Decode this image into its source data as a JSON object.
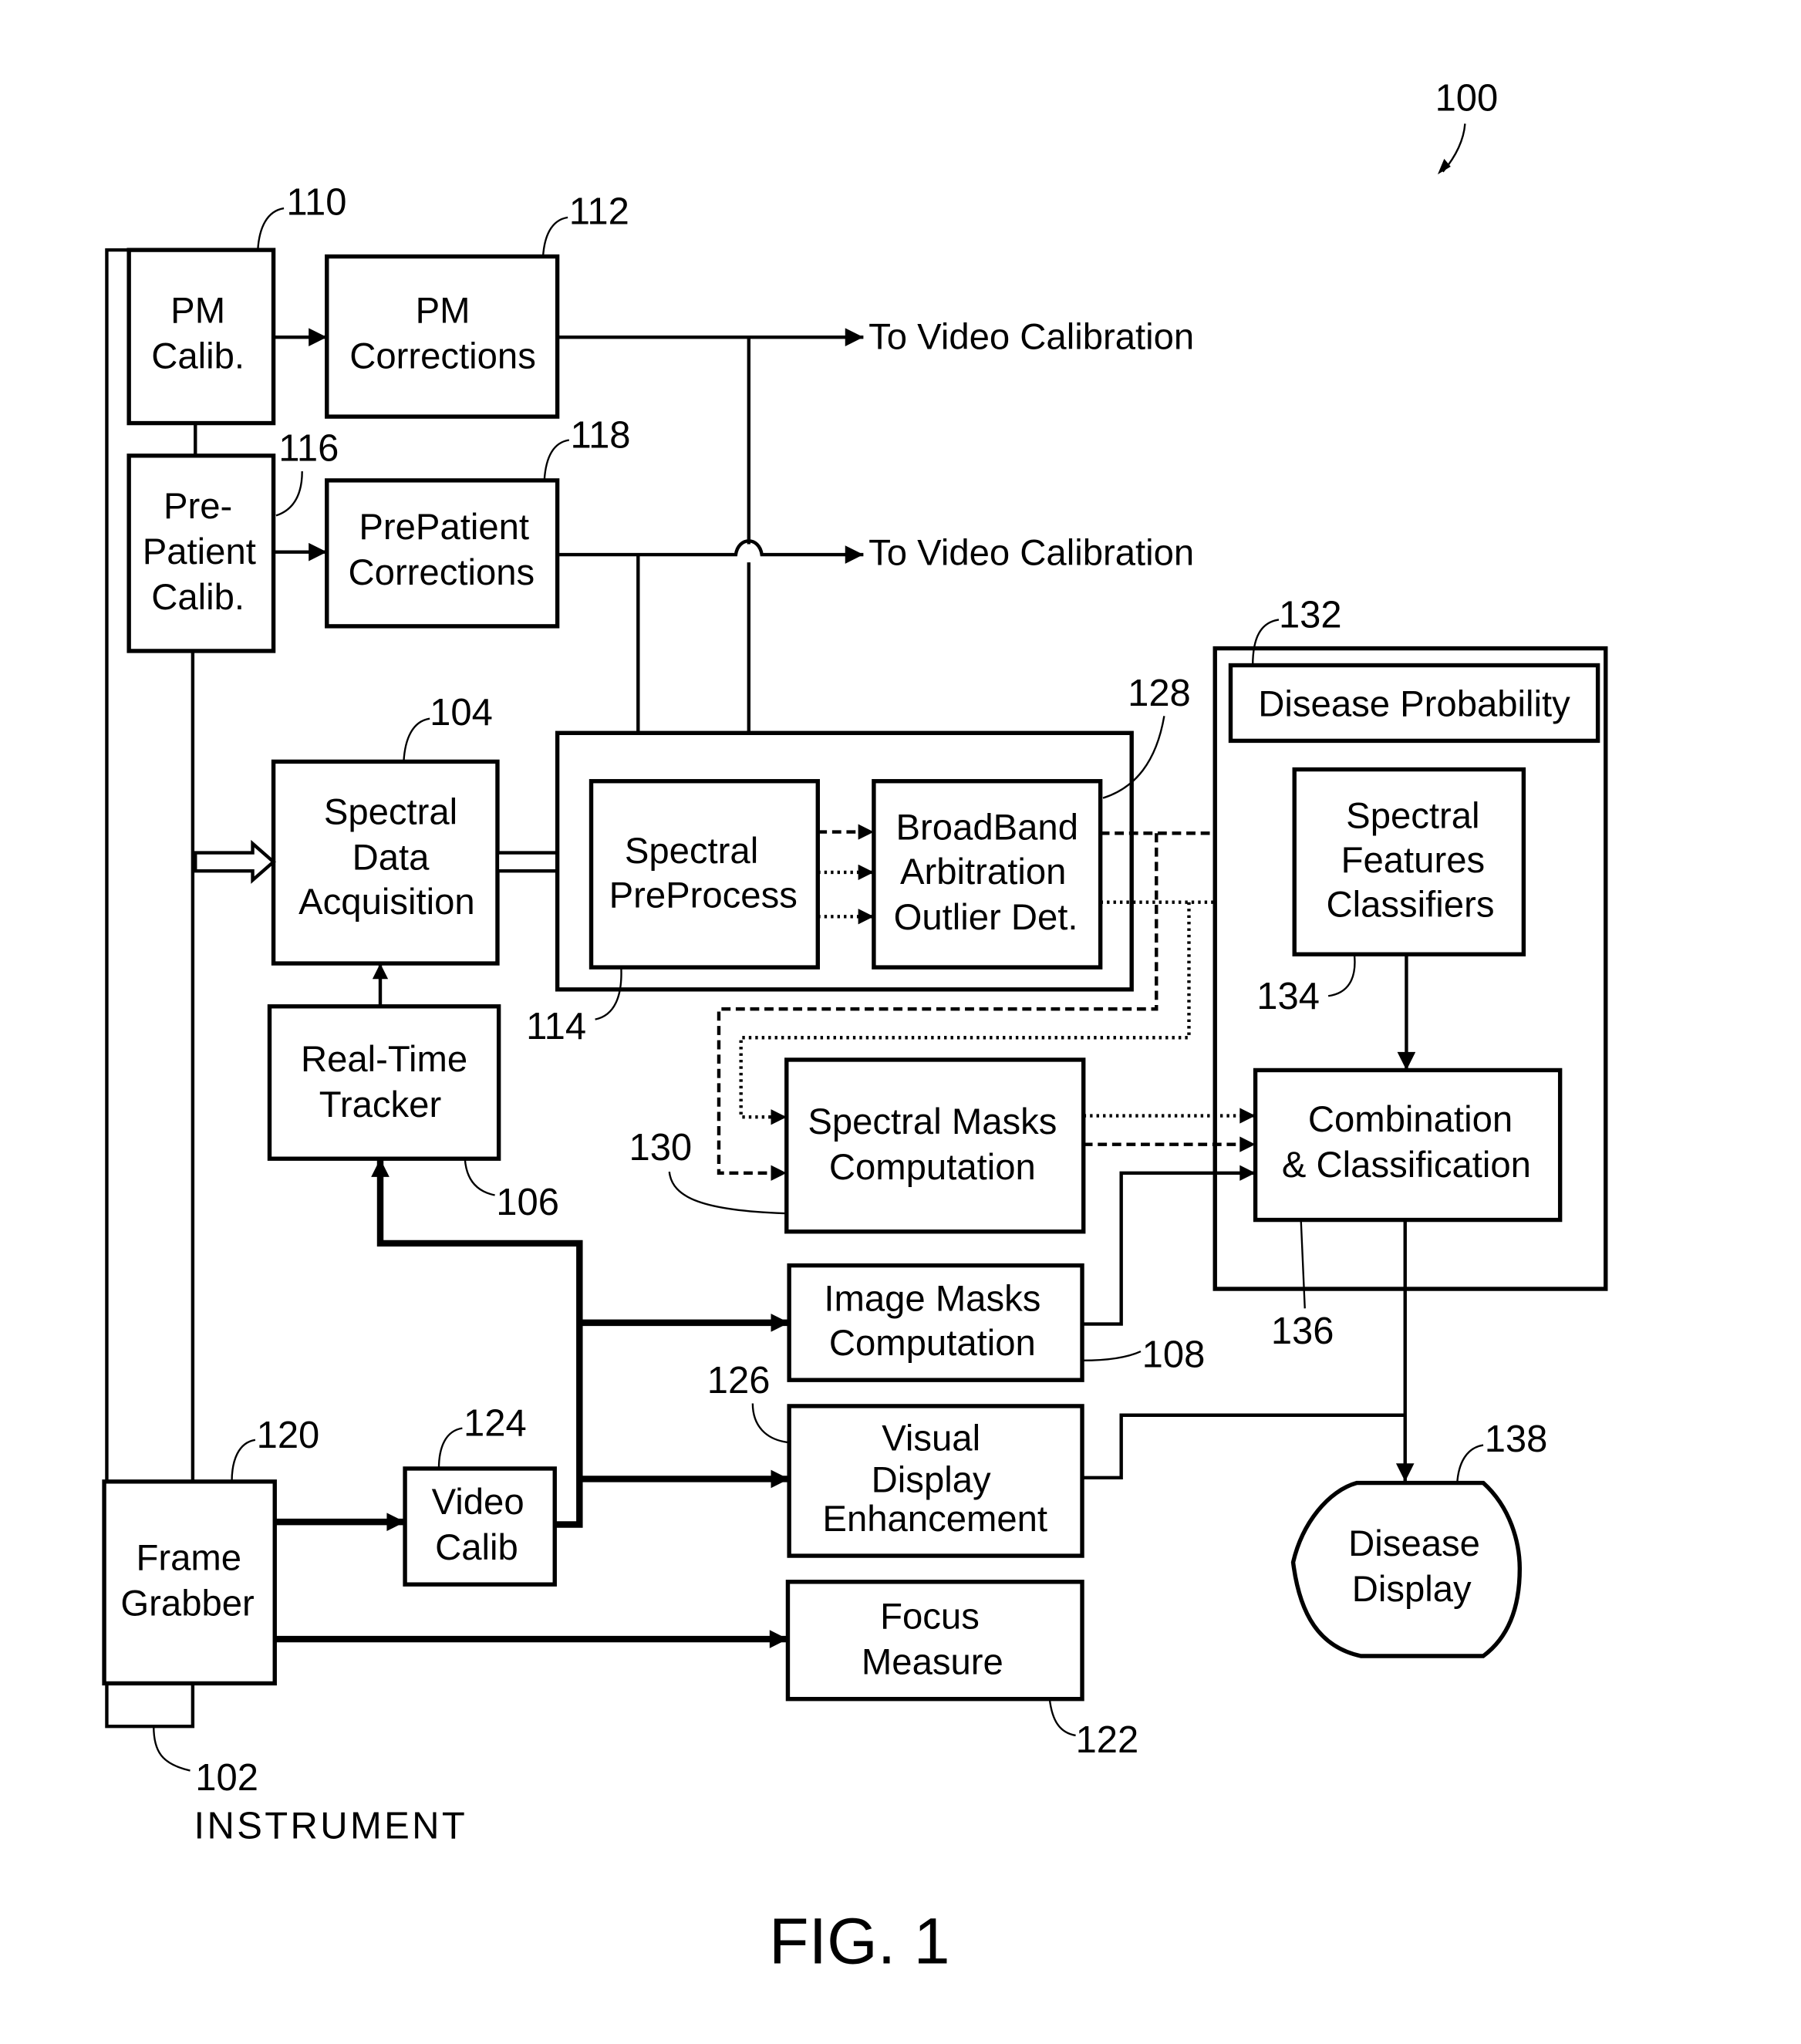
{
  "figure": {
    "title": "FIG. 1",
    "system_ref": "100",
    "instrument_ref": "102",
    "instrument_label": "INSTRUMENT"
  },
  "blocks": {
    "pm_calib": {
      "ref": "110",
      "lines": [
        "PM",
        "Calib."
      ]
    },
    "pm_corrections": {
      "ref": "112",
      "lines": [
        "PM",
        "Corrections"
      ]
    },
    "pre_patient_calib": {
      "ref": "116",
      "lines": [
        "Pre-",
        "Patient",
        "Calib."
      ]
    },
    "prepatient_corrections": {
      "ref": "118",
      "lines": [
        "PrePatient",
        "Corrections"
      ]
    },
    "spectral_data_acquisition": {
      "ref": "104",
      "lines": [
        "Spectral",
        "Data",
        "Acquisition"
      ]
    },
    "real_time_tracker": {
      "ref": "106",
      "lines": [
        "Real-Time",
        "Tracker"
      ]
    },
    "preprocess_group": {
      "ref": "114"
    },
    "spectral_preprocess": {
      "lines": [
        "Spectral",
        "PreProcess"
      ]
    },
    "broadband_arbitration": {
      "ref": "128",
      "lines": [
        "BroadBand",
        "Arbitration",
        "Outlier Det."
      ]
    },
    "disease_probability_group": {
      "ref": "132",
      "title": "Disease Probability"
    },
    "spectral_features_classifiers": {
      "ref": "134",
      "lines": [
        "Spectral",
        "Features",
        "Classifiers"
      ]
    },
    "spectral_masks_computation": {
      "ref": "130",
      "lines": [
        "Spectral Masks",
        "Computation"
      ]
    },
    "combination_classification": {
      "ref": "136",
      "lines": [
        "Combination",
        "& Classification"
      ]
    },
    "image_masks_computation": {
      "ref": "108",
      "lines": [
        "Image Masks",
        "Computation"
      ]
    },
    "visual_display_enhancement": {
      "ref": "126",
      "lines": [
        "Visual",
        "Display",
        "Enhancement"
      ]
    },
    "focus_measure": {
      "ref": "122",
      "lines": [
        "Focus",
        "Measure"
      ]
    },
    "frame_grabber": {
      "ref": "120",
      "lines": [
        "Frame",
        "Grabber"
      ]
    },
    "video_calib": {
      "ref": "124",
      "lines": [
        "Video",
        "Calib"
      ]
    },
    "disease_display": {
      "ref": "138",
      "lines": [
        "Disease",
        "Display"
      ]
    }
  },
  "outputs": {
    "pm_to_video": "To Video Calibration",
    "prepatient_to_video": "To Video Calibration"
  }
}
